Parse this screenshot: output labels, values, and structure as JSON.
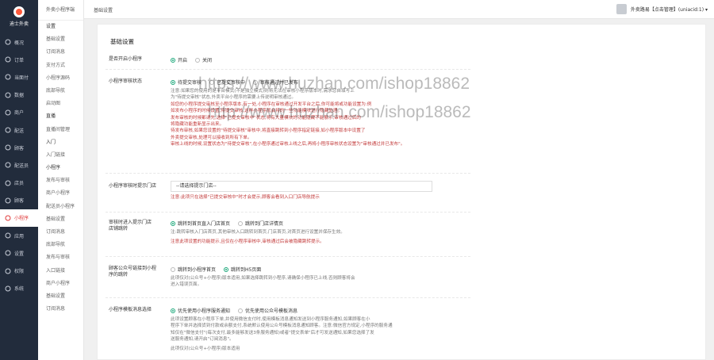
{
  "app": {
    "logo_text": "迪士外卖"
  },
  "nav": [
    {
      "label": "概况",
      "icon": "overview-icon"
    },
    {
      "label": "订单",
      "icon": "order-icon"
    },
    {
      "label": "当面付",
      "icon": "pay-icon"
    },
    {
      "label": "数据",
      "icon": "data-icon"
    },
    {
      "label": "商户",
      "icon": "store-icon"
    },
    {
      "label": "配送",
      "icon": "delivery-icon"
    },
    {
      "label": "顾客",
      "icon": "customer-icon"
    },
    {
      "label": "配送员",
      "icon": "courier-icon"
    },
    {
      "label": "店员",
      "icon": "clerk-icon"
    },
    {
      "label": "顾客",
      "icon": "user-icon"
    },
    {
      "label": "小程序",
      "icon": "miniapp-icon"
    },
    {
      "label": "应用",
      "icon": "apps-icon"
    },
    {
      "label": "设置",
      "icon": "settings-icon"
    },
    {
      "label": "权限",
      "icon": "permission-icon"
    },
    {
      "label": "系统",
      "icon": "system-icon"
    }
  ],
  "subnav": {
    "head": "外卖小程序端",
    "items": [
      "设置",
      "基础设置",
      "订阅消息",
      "支付方式",
      "小程序源码",
      "底部导航",
      "启动图",
      "直播",
      "直播间管理",
      "入门",
      "入门链接",
      "小程序",
      "发布与审核",
      "商户小程序",
      "配送员小程序",
      "基础设置",
      "订阅消息",
      "底部导航",
      "发布与审核",
      "入口链接",
      "商户小程序",
      "基础设置",
      "订阅消息"
    ]
  },
  "topbar": {
    "crumb": "基础设置",
    "user": "外卖路易【点击管理】(uniacid:1) ▾"
  },
  "page": {
    "title": "基础设置",
    "rows": {
      "open": {
        "label": "是否开启小程序",
        "opt1": "开启",
        "opt2": "关闭"
      },
      "status": {
        "label": "小程序审核状态",
        "opt1": "待提交审核",
        "opt2": "已提交审核中",
        "opt3": "审核通过并已发布",
        "help": [
          "注意:如果您的使用的是平台模式(不是独立模式)则将无法在审核小程序版本时,需求您自填写上",
          "为\"待提交审核\"状态,外卖平台小程序的需要上传说明审核通过。",
          "如您的小程序提交审核至小程序版本,有一处,小程序在审核通过开发平台之后,你可能将或功能设置为:例",
          "如发布小程序的时候设置,待提交审核,这样小程序就会将的一些功能模块进行隐藏处理。",
          "发布审核的时候都请先,选择\"已提交审核中\"状态,将有大量模块的功能隐藏不能展示,审核通过后的",
          "将隐藏功能重新显示出来。",
          "待发布审核,如果您设置的\"待提交审核\"审核中,将直接跳转到小程序指定链接,如小程序版本中设置了",
          "外卖提交审核,处理可以接收到所有下单。",
          "审核上线的时候,设置状态为\"待提交审核\",在小程序通过审核上线之后,再将小程序审核状态设置为\"审核通过并已发布\"。"
        ]
      },
      "tips": {
        "label": "小程序审核时提示门店",
        "placeholder": "--请选择提示门店--",
        "help": "注意:此项只在选择\"已提交审核中\"时才会提示,顾客会看到入口门店导航提示"
      },
      "entrance": {
        "label": "审核时进入提示门店",
        "label2": "店铺跳转",
        "opt1": "跳转到首页直入门店首页",
        "opt2": "跳转到门店详情页",
        "help1": "注:跳转审核入门店首页,其他审核入口跳转到首页,门店首页,对首页进行设置并保存生效。",
        "help2": "注意此项设置的功能提示,且仅在小程序审核中,审核通过后会被隐藏跳转提示。"
      },
      "public": {
        "label": "顾客公众号链接到小程",
        "label2": "序的跳转",
        "opt1": "跳转到小程序首页",
        "opt2": "跳转到H5页面",
        "help1": "此项仅对(公众号+小程序)版本适用,如果选择跳转到小程序,请确保小程序已上线,否则顾客将会",
        "help2": "进入错误页面。"
      },
      "notice": {
        "label": "小程序模板消息选择",
        "opt1": "优先使用小程序服务通知",
        "opt2": "优先使用公众号模板消息",
        "help": [
          "此项设置顾客在小程序下单,并使用微信支付时,使用模板消息通知发送到小程序服务通知,如果顾客在小",
          "程序下单并选择货到付款或余额支付,系统默认使用公众号模板消息通知顾客。注意:微信官方规定,小程序的服务通",
          "知仅在\"微信支付\"(每次支付,最多能够发送3条服务通知)或者\"提交表单\"后才可发送通知,如果您选择了发",
          "送服务通知,请开启\"订阅消息\"。",
          "此项仅对(公众号+小程序)版本适用"
        ]
      }
    }
  },
  "watermark": {
    "line1": "https://www.huzhan.com/ishop18862",
    "line2": "http://www.huzhan.com/ishop18862"
  }
}
